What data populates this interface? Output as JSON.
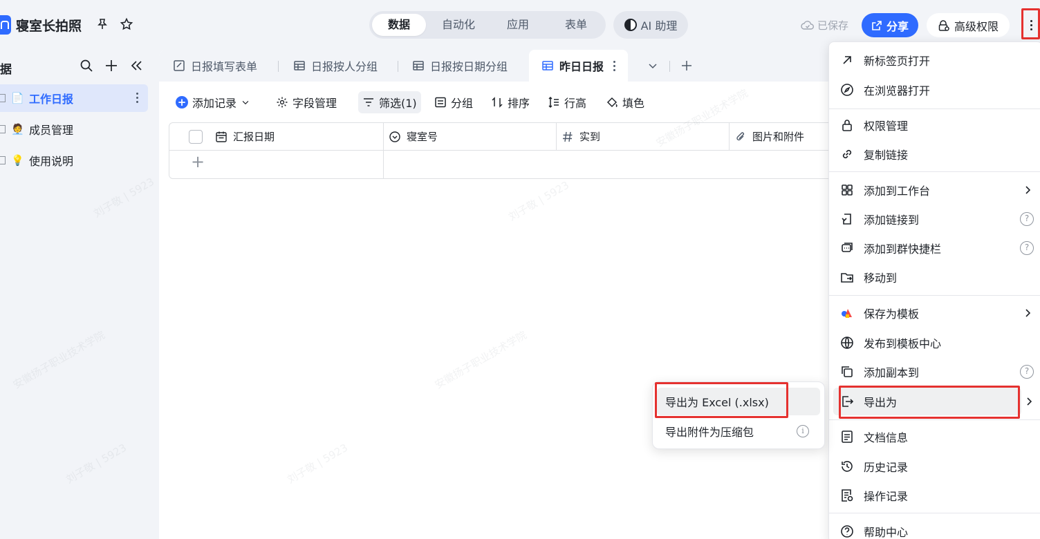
{
  "app": {
    "title": "寝室长拍照"
  },
  "nav_tabs": [
    {
      "label": "数据",
      "active": true
    },
    {
      "label": "自动化",
      "active": false
    },
    {
      "label": "应用",
      "active": false
    },
    {
      "label": "表单",
      "active": false
    }
  ],
  "ai_button": "AI 助理",
  "save_status": "已保存",
  "share_button": "分享",
  "permission_button": "高级权限",
  "sidebar": {
    "heading": "据",
    "items": [
      {
        "label": "工作日报",
        "icon": "📄",
        "active": true
      },
      {
        "label": "成员管理",
        "icon": "🧑‍💼",
        "active": false
      },
      {
        "label": "使用说明",
        "icon": "💡",
        "active": false
      }
    ]
  },
  "view_tabs": [
    {
      "label": "日报填写表单",
      "icon": "form-icon"
    },
    {
      "label": "日报按人分组",
      "icon": "table-icon"
    },
    {
      "label": "日报按日期分组",
      "icon": "table-icon"
    },
    {
      "label": "昨日日报",
      "icon": "table-icon",
      "active": true
    }
  ],
  "toolbar": {
    "add_record": "添加记录",
    "fields": "字段管理",
    "filter": "筛选(1)",
    "group": "分组",
    "sort": "排序",
    "row_height": "行高",
    "fill_color": "填色"
  },
  "columns": [
    {
      "label": "汇报日期",
      "icon": "calendar-icon"
    },
    {
      "label": "寝室号",
      "icon": "single-select-icon"
    },
    {
      "label": "实到",
      "icon": "number-icon"
    },
    {
      "label": "图片和附件",
      "icon": "attachment-icon"
    }
  ],
  "watermark": {
    "line1": "刘子敬 | 5923",
    "line2": "安徽扬子职业技术学院"
  },
  "menu": {
    "items": [
      {
        "label": "新标签页打开",
        "icon": "arrow-up-right-icon"
      },
      {
        "label": "在浏览器打开",
        "icon": "compass-icon"
      },
      {
        "label": "权限管理",
        "icon": "lock-icon"
      },
      {
        "label": "复制链接",
        "icon": "link-icon"
      },
      {
        "label": "添加到工作台",
        "icon": "grid-icon",
        "submenu": true
      },
      {
        "label": "添加链接到",
        "icon": "link-to-icon",
        "help": true
      },
      {
        "label": "添加到群快捷栏",
        "icon": "chat-icon",
        "help": true
      },
      {
        "label": "移动到",
        "icon": "folder-move-icon"
      },
      {
        "label": "保存为模板",
        "icon": "template-icon",
        "submenu": true
      },
      {
        "label": "发布到模板中心",
        "icon": "globe-icon"
      },
      {
        "label": "添加副本到",
        "icon": "copy-icon",
        "help": true
      },
      {
        "label": "导出为",
        "icon": "export-icon",
        "submenu": true,
        "highlighted": true
      },
      {
        "label": "文档信息",
        "icon": "doc-info-icon"
      },
      {
        "label": "历史记录",
        "icon": "history-icon"
      },
      {
        "label": "操作记录",
        "icon": "log-icon"
      },
      {
        "label": "帮助中心",
        "icon": "help-icon"
      }
    ]
  },
  "export_submenu": [
    {
      "label": "导出为 Excel (.xlsx)",
      "highlighted": true
    },
    {
      "label": "导出附件为压缩包",
      "info": true
    }
  ],
  "colors": {
    "accent": "#2f6bff",
    "highlight_frame": "#e5312f"
  }
}
